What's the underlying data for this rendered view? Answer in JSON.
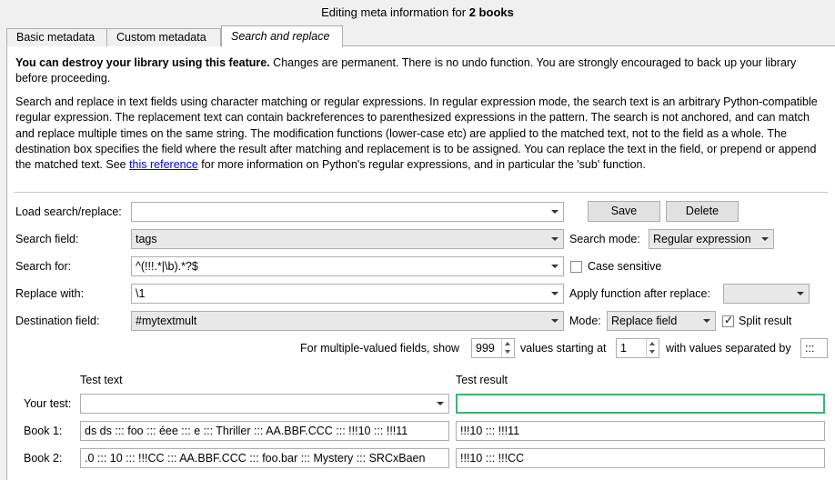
{
  "window": {
    "title_prefix": "Editing meta information for ",
    "title_bold": "2 books"
  },
  "tabs": [
    "Basic metadata",
    "Custom metadata",
    "Search and replace"
  ],
  "warning": {
    "bold": "You can destroy your library using this feature.",
    "rest": " Changes are permanent. There is no undo function. You are strongly encouraged to back up your library before proceeding."
  },
  "help": {
    "before_link": "Search and replace in text fields using character matching or regular expressions. In regular expression mode, the search text is an arbitrary Python-compatible regular expression. The replacement text can contain backreferences to parenthesized expressions in the pattern. The search is not anchored, and can match and replace multiple times on the same string. The modification functions (lower-case etc) are applied to the matched text, not to the field as a whole. The destination box specifies the field where the result after matching and replacement is to be assigned. You can replace the text in the field, or prepend or append the matched text. See ",
    "link": "this reference",
    "after_link": " for more information on Python's regular expressions, and in particular the 'sub' function."
  },
  "form": {
    "load_label": "Load search/replace:",
    "load_value": "",
    "save_label": "Save",
    "delete_label": "Delete",
    "search_field_label": "Search field:",
    "search_field_value": "tags",
    "search_mode_label": "Search mode:",
    "search_mode_value": "Regular expression",
    "search_for_label": "Search for:",
    "search_for_value": "^(!!!.*|\\b).*?$",
    "case_sensitive_label": "Case sensitive",
    "case_sensitive": false,
    "replace_with_label": "Replace with:",
    "replace_with_value": "\\1",
    "apply_function_label": "Apply function after replace:",
    "apply_function_value": "",
    "destination_label": "Destination field:",
    "destination_value": "#mytextmult",
    "mode_label": "Mode:",
    "mode_value": "Replace field",
    "split_result_label": "Split result",
    "split_result": true,
    "multi_label_1": "For multiple-valued fields, show",
    "multi_show_value": "999",
    "multi_label_2": "values starting at",
    "multi_start_value": "1",
    "multi_label_3": "with values separated by",
    "multi_sep_value": ":::"
  },
  "test": {
    "test_text_header": "Test text",
    "test_result_header": "Test result",
    "your_test_label": "Your test:",
    "your_test_value": "",
    "your_test_result": "",
    "book1_label": "Book 1:",
    "book1_text": "ds ds ::: foo ::: éee ::: e ::: Thriller ::: AA.BBF.CCC ::: !!!10 ::: !!!11",
    "book1_result": "!!!10 ::: !!!11",
    "book2_label": "Book 2:",
    "book2_text": ".0 ::: 10 ::: !!!CC ::: AA.BBF.CCC ::: foo.bar ::: Mystery ::: SRCxBaen",
    "book2_result": "!!!10 ::: !!!CC"
  }
}
